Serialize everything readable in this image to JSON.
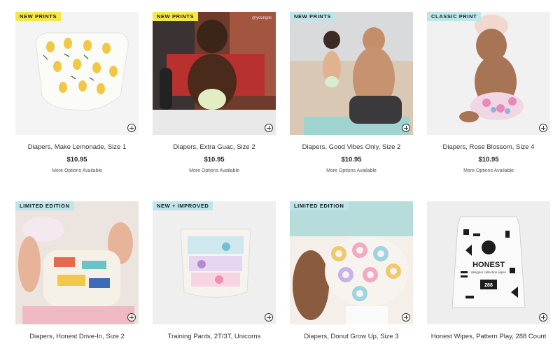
{
  "colors": {
    "badge_yellow": "#f6e64a",
    "badge_blue": "#bfe5ea",
    "price": "#222222"
  },
  "products": [
    {
      "badge": "NEW PRINTS",
      "badge_color": "yellow",
      "title": "Diapers, Make Lemonade, Size 1",
      "price": "$10.95",
      "options": "More Options Available"
    },
    {
      "badge": "NEW PRINTS",
      "badge_color": "yellow",
      "title": "Diapers, Extra Guac, Size 2",
      "price": "$10.95",
      "options": "More Options Available",
      "watermark": "@youngils"
    },
    {
      "badge": "NEW PRINTS",
      "badge_color": "blue",
      "title": "Diapers, Good Vibes Only, Size 2",
      "price": "$10.95",
      "options": "More Options Available"
    },
    {
      "badge": "CLASSIC PRINT",
      "badge_color": "blue",
      "title": "Diapers, Rose Blossom, Size 4",
      "price": "$10.95",
      "options": "More Options Available"
    },
    {
      "badge": "LIMITED EDITION",
      "badge_color": "blue",
      "title": "Diapers, Honest Drive-In, Size 2"
    },
    {
      "badge": "NEW + IMPROVED",
      "badge_color": "blue",
      "title": "Training Pants, 2T/3T, Unicorns"
    },
    {
      "badge": "LIMITED EDITION",
      "badge_color": "blue",
      "title": "Diapers, Donut Grow Up, Size 3"
    },
    {
      "title": "Honest Wipes, Pattern Play, 288 Count",
      "package_brand": "HONEST",
      "package_sub": "designer collection wipes",
      "package_count": "288"
    }
  ]
}
